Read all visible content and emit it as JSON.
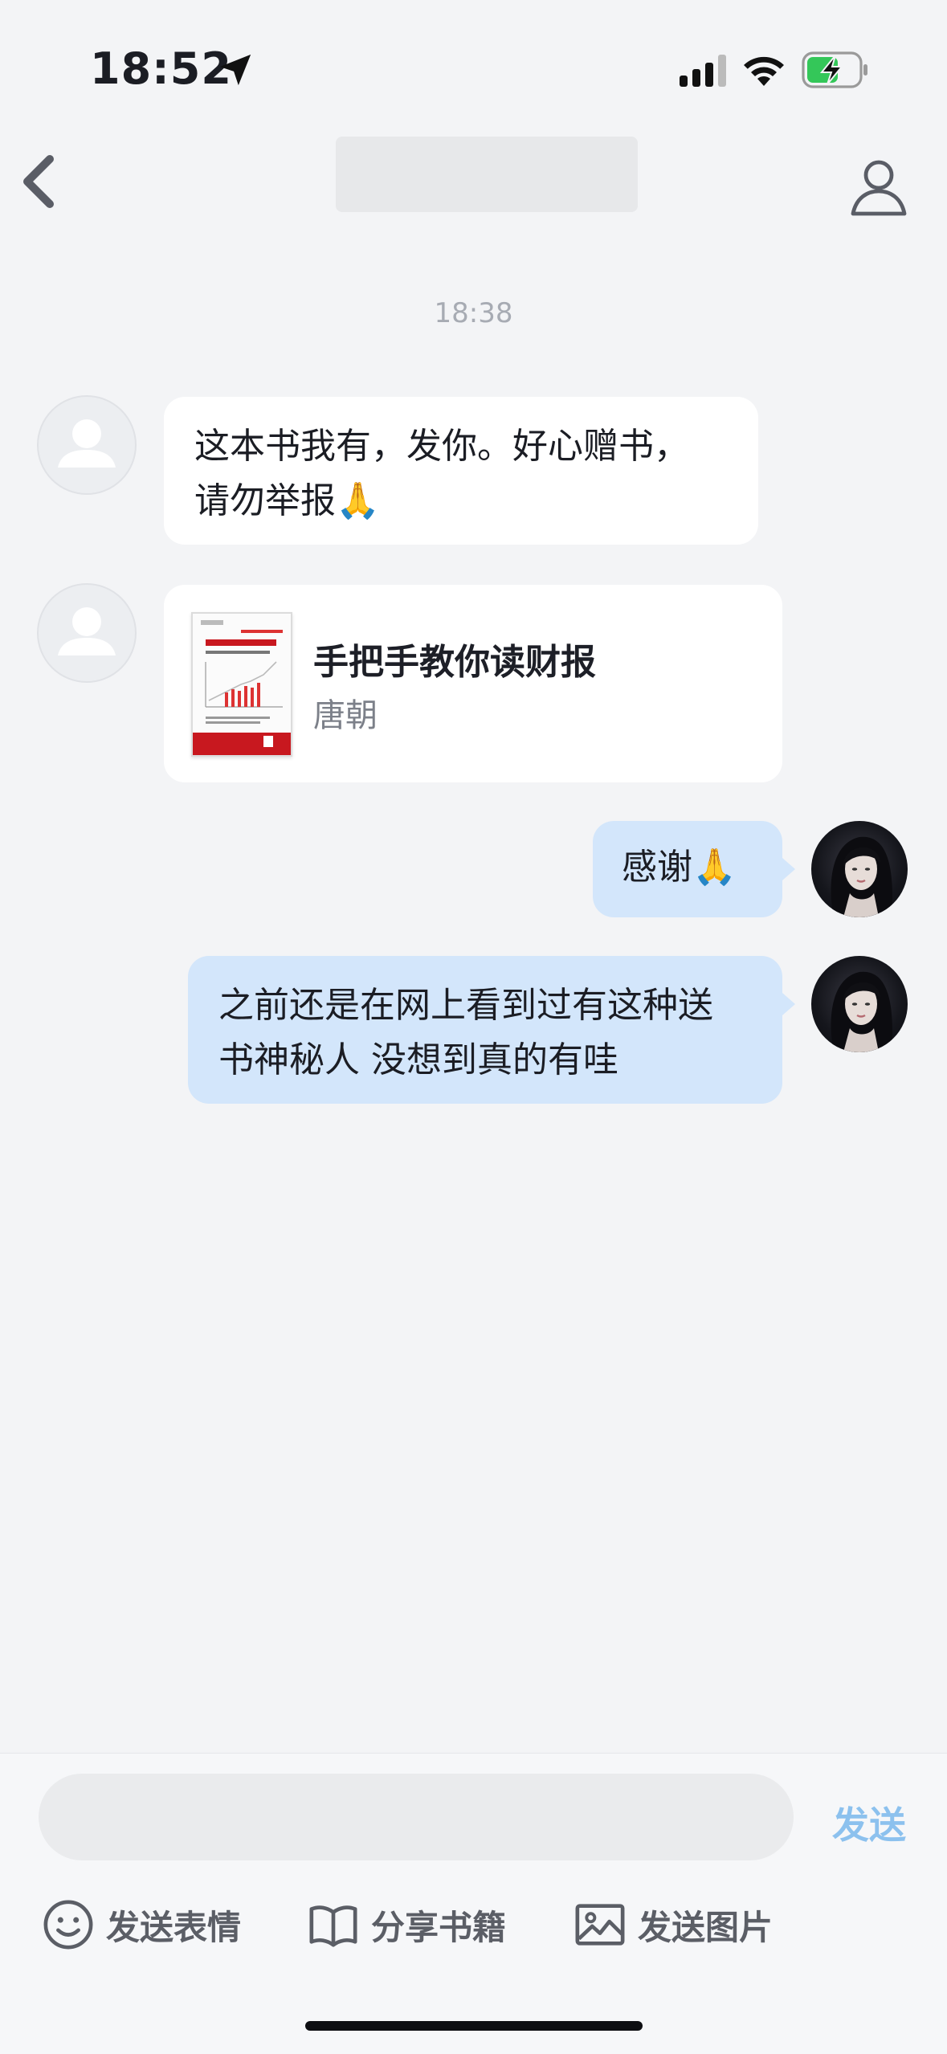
{
  "status_bar": {
    "time": "18:52"
  },
  "chat": {
    "timestamp": "18:38",
    "messages": [
      {
        "id": "m1",
        "side": "in",
        "line1": "这本书我有，发你。好心赠书，",
        "line2": "请勿举报🙏"
      },
      {
        "id": "m2",
        "side": "in",
        "type": "book",
        "book_title": "手把手教你读财报",
        "book_author": "唐朝"
      },
      {
        "id": "m3",
        "side": "out",
        "text": "感谢🙏"
      },
      {
        "id": "m4",
        "side": "out",
        "line1": "之前还是在网上看到过有这种送",
        "line2": "书神秘人 没想到真的有哇"
      }
    ]
  },
  "composer": {
    "send_label": "发送",
    "actions": {
      "emoji": "发送表情",
      "share_book": "分享书籍",
      "send_image": "发送图片"
    }
  },
  "icons": [
    "back-icon",
    "profile-icon",
    "location-arrow-icon",
    "signal-icon",
    "wifi-icon",
    "battery-charging-icon",
    "emoji-icon",
    "book-icon",
    "image-icon"
  ]
}
